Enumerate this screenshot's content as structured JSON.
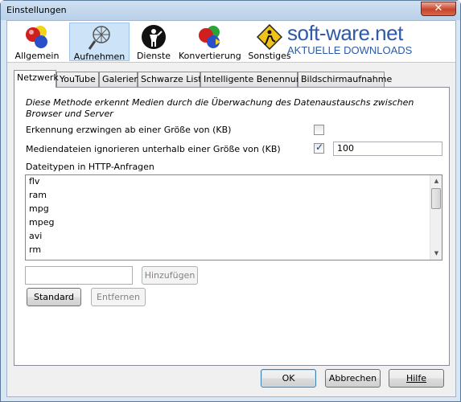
{
  "window": {
    "title": "Einstellungen",
    "close_glyph": "✕"
  },
  "toolbar": {
    "items": [
      {
        "label": "Allgemein",
        "icon": "colored-balls-icon",
        "selected": false
      },
      {
        "label": "Aufnehmen",
        "icon": "network-globe-icon",
        "selected": true
      },
      {
        "label": "Dienste",
        "icon": "services-figure-icon",
        "selected": false
      },
      {
        "label": "Konvertierung",
        "icon": "convert-balls-icon",
        "selected": false
      },
      {
        "label": "Sonstiges",
        "icon": "misc-sign-icon",
        "selected": false
      }
    ]
  },
  "watermark": {
    "brand": "soft-ware.net",
    "tagline": "AKTUELLE DOWNLOADS",
    "color": "#2e5aa8"
  },
  "tabs": [
    {
      "label": "Netzwerk",
      "active": true
    },
    {
      "label": "YouTube",
      "active": false
    },
    {
      "label": "Galerien",
      "active": false
    },
    {
      "label": "Schwarze Liste",
      "active": false
    },
    {
      "label": "Intelligente Benennung",
      "active": false
    },
    {
      "label": "Bildschirmaufnahme",
      "active": false
    }
  ],
  "network": {
    "description": "Diese Methode erkennt Medien durch die Überwachung des Datenaustauschs zwischen Browser und Server",
    "force_detection_label": "Erkennung erzwingen ab einer Größe von (KB)",
    "force_detection_checked": false,
    "ignore_small_label": "Mediendateien ignorieren unterhalb einer Größe von (KB)",
    "ignore_small_checked": true,
    "ignore_small_value": "100",
    "filetypes_label": "Dateitypen in HTTP-Anfragen",
    "filetypes": [
      "flv",
      "ram",
      "mpg",
      "mpeg",
      "avi",
      "rm"
    ],
    "add_input_value": "",
    "add_button": "Hinzufügen",
    "default_button": "Standard",
    "remove_button": "Entfernen"
  },
  "footer": {
    "ok": "OK",
    "cancel": "Abbrechen",
    "help": "Hilfe"
  }
}
